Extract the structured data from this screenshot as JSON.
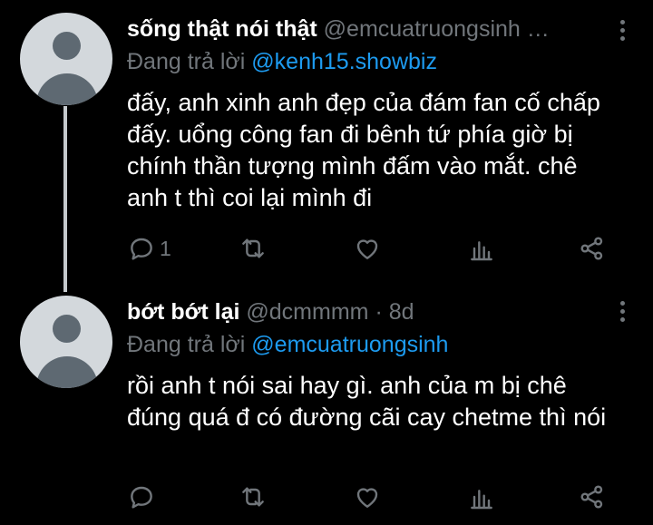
{
  "tweets": [
    {
      "display_name": "sống thật nói thật",
      "handle": "@emcuatruongsinh …",
      "reply_prefix": "Đang trả lời",
      "reply_to": "@kenh15.showbiz",
      "text": "đấy, anh xinh anh đẹp của đám fan cố chấp đấy. uổng công fan đi bênh tứ phía giờ bị chính thần tượng mình đấm vào mắt. chê anh t thì coi lại mình đi",
      "reply_count": "1",
      "icons": [
        "reply-icon",
        "retweet-icon",
        "like-icon",
        "analytics-icon",
        "share-icon"
      ]
    },
    {
      "display_name": "bớt bớt lại",
      "handle": "@dcmmmm",
      "separator": "·",
      "time": "8d",
      "reply_prefix": "Đang trả lời",
      "reply_to": "@emcuatruongsinh",
      "text": "rồi anh t nói sai hay gì. anh của m bị chê đúng quá đ có đường cãi cay chetme thì nói",
      "icons": [
        "reply-icon",
        "retweet-icon",
        "like-icon",
        "analytics-icon",
        "share-icon"
      ]
    }
  ],
  "colors": {
    "background": "#000000",
    "text": "#ffffff",
    "secondary": "#71767b",
    "link": "#1d9bf0",
    "thread_line": "#c4c9cd"
  }
}
